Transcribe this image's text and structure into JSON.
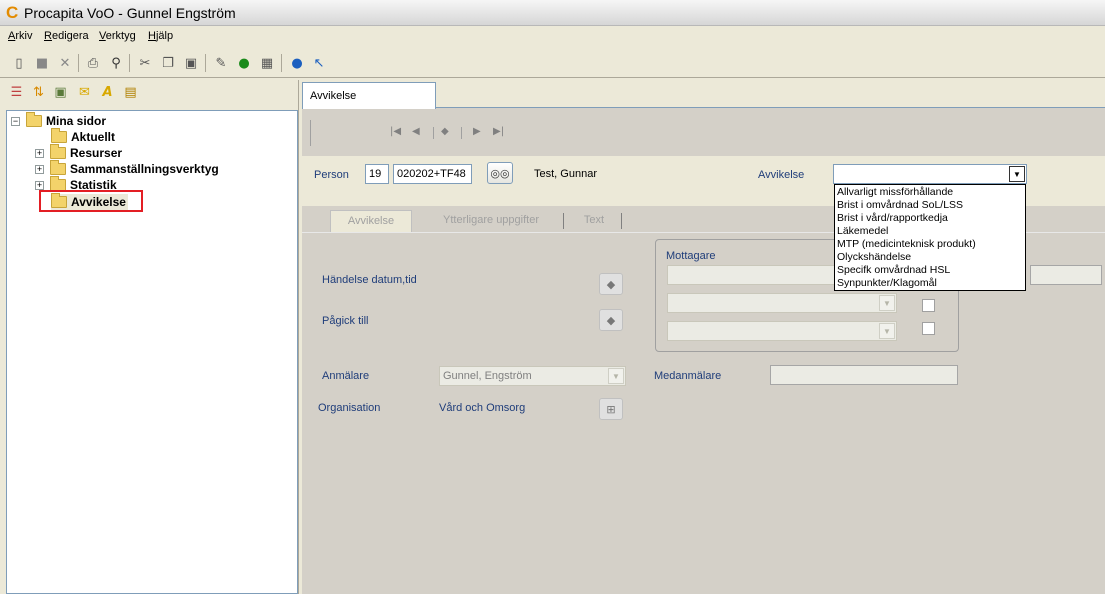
{
  "window": {
    "title": "Procapita VoO - Gunnel Engström",
    "logo_letter": "C"
  },
  "menu": [
    {
      "label": "Arkiv"
    },
    {
      "label": "Redigera"
    },
    {
      "label": "Verktyg"
    },
    {
      "label": "Hjälp"
    }
  ],
  "tree": {
    "root": "Mina sidor",
    "items": [
      "Aktuellt",
      "Resurser",
      "Sammanställningsverktyg",
      "Statistik",
      "Avvikelse"
    ]
  },
  "tab": {
    "label": "Avvikelse"
  },
  "person": {
    "label": "Person",
    "century": "19",
    "id": "020202+TF48",
    "name": "Test, Gunnar"
  },
  "avvikelse": {
    "label": "Avvikelse",
    "value": "",
    "options": [
      "Allvarligt missförhållande",
      "Brist i omvårdnad SoL/LSS",
      "Brist i vård/rapportkedja",
      "Läkemedel",
      "MTP (medicinteknisk produkt)",
      "Olyckshändelse",
      "Specifk omvårdnad HSL",
      "Synpunkter/Klagomål"
    ]
  },
  "inner_tabs": [
    "Avvikelse",
    "Ytterligare uppgifter",
    "Text"
  ],
  "form": {
    "handelse_label": "Händelse datum,tid",
    "pagick_label": "Pågick till",
    "mottagare_label": "Mottagare",
    "anmalare_label": "Anmälare",
    "anmalare_value": "Gunnel, Engström",
    "medanmalare_label": "Medanmälare",
    "organisation_label": "Organisation",
    "organisation_value": "Vård och Omsorg"
  }
}
